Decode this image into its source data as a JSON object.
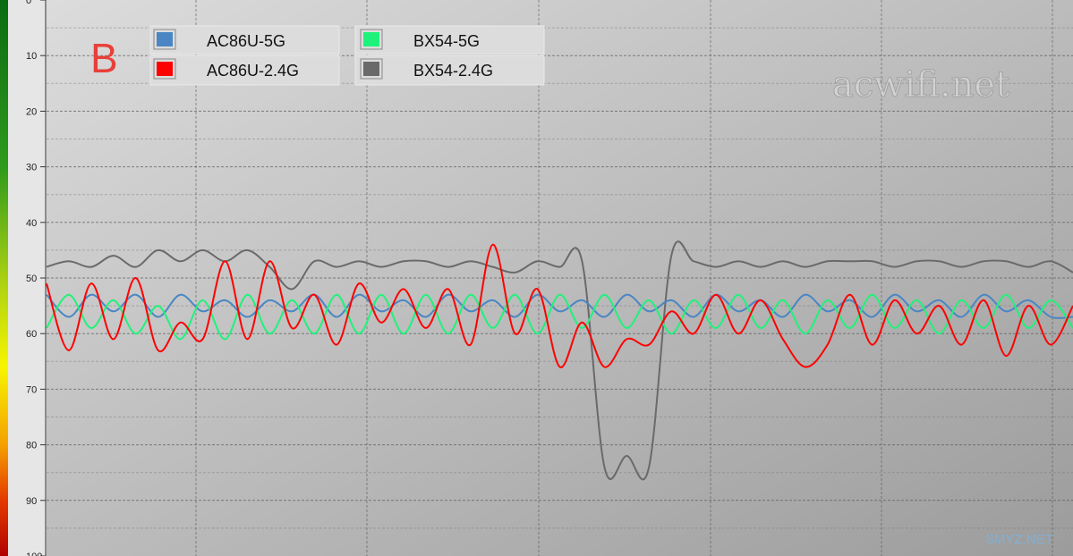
{
  "panel_label": "B",
  "watermark_main": "acwifi.net",
  "watermark_corner": "SMYZ.NET",
  "chart_data": {
    "type": "line",
    "title": "",
    "xlabel": "",
    "ylabel": "",
    "ylim": [
      0,
      100
    ],
    "y_inverted": true,
    "y_ticks": [
      "0",
      "10",
      "20",
      "30",
      "40",
      "50",
      "60",
      "70",
      "80",
      "90",
      "100"
    ],
    "grid": true,
    "legend_position": "top-left",
    "legend": [
      {
        "name": "AC86U-5G",
        "color": "#4a86c4"
      },
      {
        "name": "AC86U-2.4G",
        "color": "#ff0000"
      },
      {
        "name": "BX54-5G",
        "color": "#1ff27a"
      },
      {
        "name": "BX54-2.4G",
        "color": "#6a6a6a"
      }
    ],
    "x": [
      0,
      25,
      50,
      75,
      100,
      125,
      150,
      175,
      200,
      225,
      250,
      275,
      300,
      325,
      350,
      375,
      400,
      425,
      450,
      475,
      500,
      525,
      550,
      575,
      600,
      625,
      650,
      675,
      700,
      725,
      750,
      775,
      800,
      825,
      850,
      875,
      900,
      925,
      950,
      975,
      1000,
      1025,
      1050,
      1075,
      1100,
      1125,
      1150
    ],
    "series": [
      {
        "name": "AC86U-5G",
        "color": "#4a86c4",
        "values": [
          53,
          57,
          53,
          56,
          53,
          57,
          53,
          56,
          54,
          57,
          54,
          56,
          53,
          57,
          53,
          56,
          54,
          57,
          53,
          56,
          54,
          57,
          53,
          56,
          54,
          57,
          53,
          56,
          54,
          57,
          53,
          56,
          54,
          57,
          53,
          56,
          54,
          57,
          53,
          56,
          54,
          57,
          53,
          56,
          54,
          57,
          57
        ]
      },
      {
        "name": "AC86U-2.4G",
        "color": "#ff0000",
        "values": [
          51,
          63,
          51,
          61,
          50,
          63,
          58,
          61,
          47,
          61,
          47,
          59,
          53,
          62,
          51,
          58,
          52,
          59,
          52,
          62,
          44,
          60,
          52,
          66,
          58,
          66,
          61,
          62,
          56,
          60,
          53,
          60,
          54,
          61,
          66,
          62,
          53,
          62,
          54,
          60,
          55,
          62,
          54,
          64,
          55,
          62,
          55
        ]
      },
      {
        "name": "BX54-5G",
        "color": "#1ff27a",
        "values": [
          59,
          53,
          59,
          54,
          60,
          55,
          61,
          54,
          61,
          53,
          60,
          54,
          60,
          53,
          60,
          53,
          60,
          53,
          60,
          53,
          59,
          53,
          60,
          53,
          59,
          53,
          59,
          54,
          60,
          54,
          59,
          53,
          59,
          54,
          60,
          54,
          59,
          53,
          59,
          54,
          60,
          54,
          59,
          53,
          59,
          54,
          59
        ]
      },
      {
        "name": "BX54-2.4G",
        "color": "#6a6a6a",
        "values": [
          48,
          47,
          48,
          46,
          48,
          45,
          47,
          45,
          47,
          45,
          48,
          52,
          47,
          48,
          47,
          48,
          47,
          47,
          48,
          47,
          48,
          49,
          47,
          48,
          47,
          84,
          82,
          84,
          46,
          47,
          48,
          47,
          48,
          47,
          48,
          47,
          47,
          47,
          48,
          47,
          47,
          48,
          47,
          47,
          48,
          47,
          49
        ]
      }
    ]
  }
}
